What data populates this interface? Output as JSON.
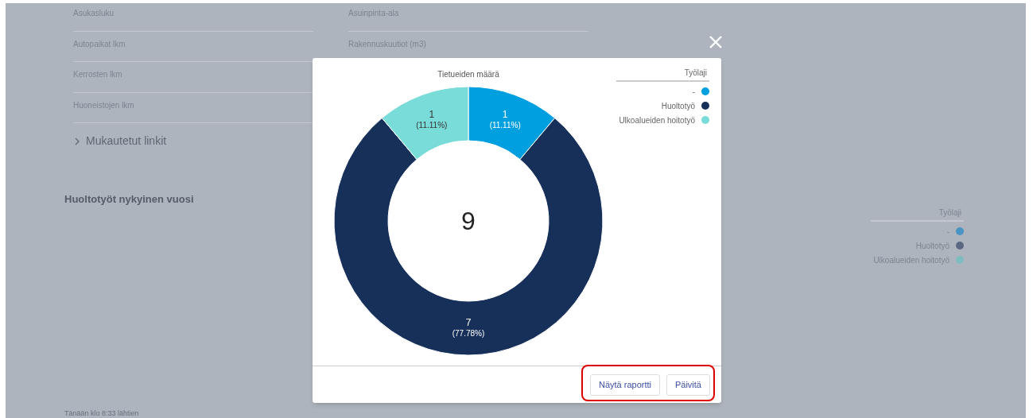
{
  "background_page": {
    "field_columns": [
      [
        {
          "label": "Asukasluku"
        },
        {
          "label": "Autopaikat lkm"
        },
        {
          "label": "Kerrosten lkm"
        },
        {
          "label": "Huoneistojen lkm"
        }
      ],
      [
        {
          "label": "Asuinpinta-ala"
        },
        {
          "label": "Rakennuskuutiot (m3)"
        }
      ]
    ],
    "custom_links": {
      "label": "Mukautetut linkit",
      "expanded": false
    },
    "section_title": "Huoltotyöt nykyinen vuosi",
    "legend": {
      "title": "Työlaji",
      "items": [
        {
          "label": "-",
          "color": "#4a94c4"
        },
        {
          "label": "Huoltotyö",
          "color": "#5a6882"
        },
        {
          "label": "Ulkoalueiden hoitotyö",
          "color": "#7fbcbf"
        }
      ]
    },
    "footer_note": "Tänään klo 8:33 lähtien"
  },
  "modal": {
    "chart": {
      "total": "9",
      "percent_labels": [
        "(11.11%)",
        "(77.78%)",
        "(11.11%)"
      ],
      "chart_data": {
        "type": "donut",
        "title": "Tietueiden määrä",
        "legend_title": "Työlaji",
        "categories": [
          "-",
          "Huoltotyö",
          "Ulkoalueiden hoitotyö"
        ],
        "colors": [
          "#00a0e0",
          "#17305a",
          "#7adcd8"
        ],
        "values": [
          1,
          7,
          1
        ],
        "data_labels": true
      }
    },
    "buttons": [
      {
        "label": "Näytä raportti"
      },
      {
        "label": "Päivitä"
      }
    ],
    "highlighted_buttons": true
  }
}
